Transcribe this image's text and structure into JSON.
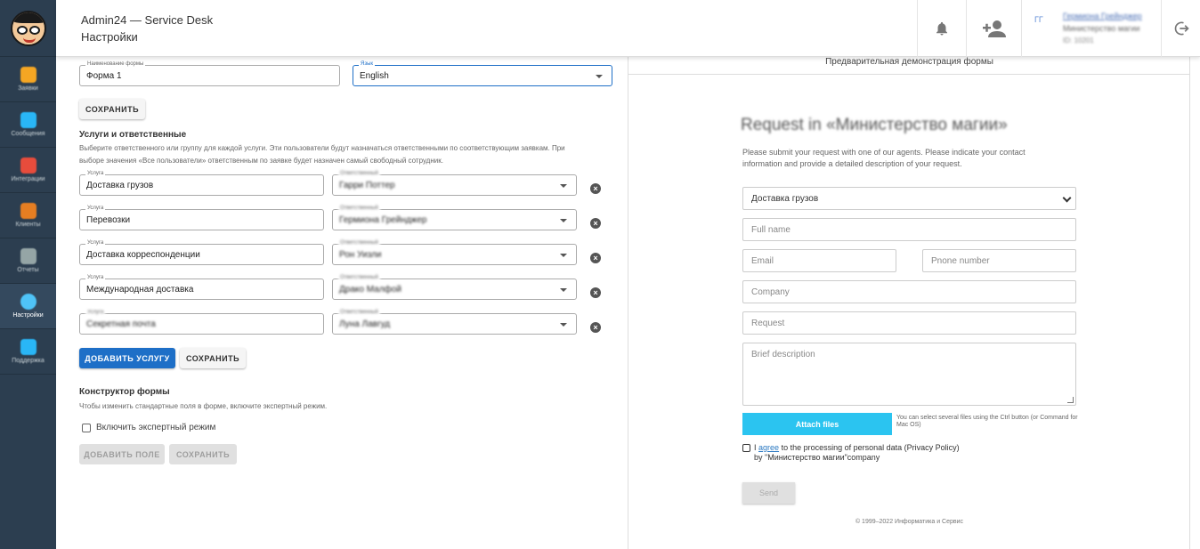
{
  "header": {
    "app_title": "Admin24 — Service Desk",
    "page_title": "Настройки",
    "user": {
      "initials": "ГГ",
      "name": "Гермиона Грейнджер",
      "org": "Министерство магии",
      "id": "ID: 10201"
    }
  },
  "sidebar": {
    "items": [
      {
        "label": "Заявки",
        "icon": "requests-icon",
        "color": "#f5a623"
      },
      {
        "label": "Сообщения",
        "icon": "messages-icon",
        "color": "#29b6f6"
      },
      {
        "label": "Интеграции",
        "icon": "integrations-icon",
        "color": "#e74c3c"
      },
      {
        "label": "Клиенты",
        "icon": "clients-icon",
        "color": "#e67e22"
      },
      {
        "label": "Отчеты",
        "icon": "reports-icon",
        "color": "#95a5a6"
      },
      {
        "label": "Настройки",
        "icon": "settings-icon",
        "color": "#4fc3f7"
      },
      {
        "label": "Поддержка",
        "icon": "support-icon",
        "color": "#29b6f6"
      }
    ]
  },
  "form_settings": {
    "name_label": "Наименование формы",
    "name_value": "Форма 1",
    "language_label": "Язык",
    "language_value": "English",
    "save_label": "СОХРАНИТЬ"
  },
  "services": {
    "title": "Услуги и ответственные",
    "description_1": "Выберите ответственного или группу для каждой услуги. Эти пользователи будут назначаться ответственными по соответствующим заявкам. При",
    "description_2": "выборе значения «Все пользователи» ответственным по заявке будет назначен самый свободный сотрудник.",
    "service_label": "Услуга",
    "responsible_label": "Ответственный",
    "rows": [
      {
        "service": "Доставка грузов",
        "responsible": "Гарри Поттер"
      },
      {
        "service": "Перевозки",
        "responsible": "Гермиона Грейнджер"
      },
      {
        "service": "Доставка корреспонденции",
        "responsible": "Рон Уизли"
      },
      {
        "service": "Международная доставка",
        "responsible": "Драко Малфой"
      },
      {
        "service": "Секретная почта",
        "responsible": "Луна Лавгуд"
      }
    ],
    "add_label": "ДОБАВИТЬ УСЛУГУ",
    "save_label": "СОХРАНИТЬ"
  },
  "constructor": {
    "title": "Конструктор формы",
    "description": "Чтобы изменить стандартные поля в форме, включите экспертный режим.",
    "expert_label": "Включить экспертный режим",
    "add_field_label": "ДОБАВИТЬ ПОЛЕ",
    "save_label": "СОХРАНИТЬ"
  },
  "preview": {
    "header": "Предварительная демонстрация формы",
    "title": "Request in «Министерство магии»",
    "description": "Please submit your request with one of our agents. Please indicate your contact information and provide a detailed description of your request.",
    "service_select": "Доставка грузов",
    "full_name": "Full name",
    "email": "Email",
    "phone": "Pnone number",
    "company": "Company",
    "request": "Request",
    "brief": "Brief description",
    "attach": "Attach files",
    "attach_note": "You can select several files using the Ctrl button (or Command for Mac OS)",
    "agree_pre": "I",
    "agree_link": "agree",
    "agree_post": "to the processing of personal data (Privacy Policy)",
    "agree_line2": "by \"Министерство магии\"company",
    "send": "Send",
    "footer": "© 1999–2022 Информатика и Сервис"
  },
  "colors": {
    "sidebar": "#2c3e50",
    "primary": "#1e6fc7",
    "attach": "#2bc4f0",
    "link": "#2b79c2"
  }
}
